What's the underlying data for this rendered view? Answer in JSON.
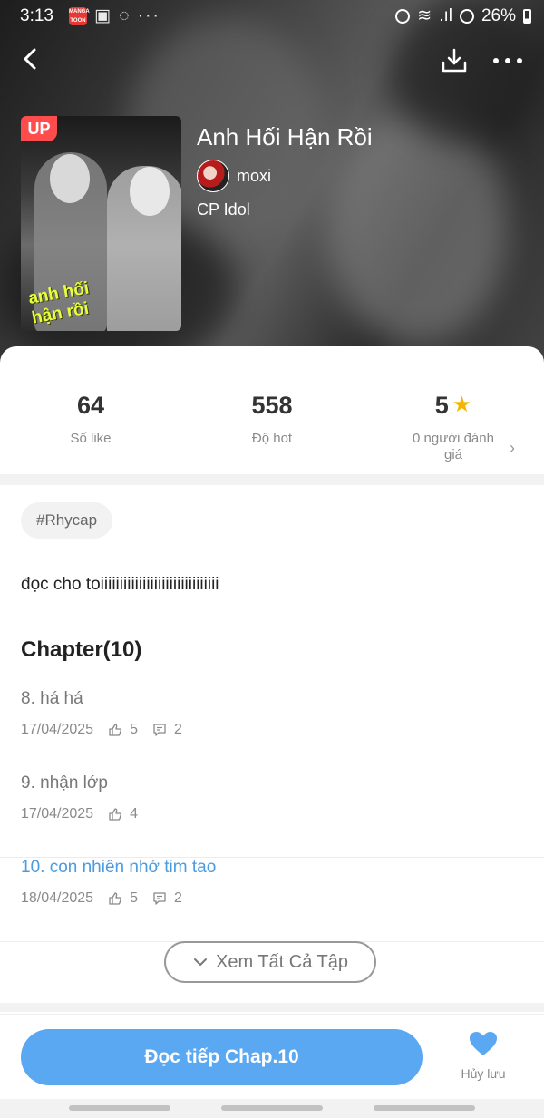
{
  "status_bar": {
    "time": "3:13",
    "battery": "26%"
  },
  "manga": {
    "title": "Anh Hối Hận Rồi",
    "author": "moxi",
    "genre": "CP Idol",
    "badge": "UP",
    "cover_caption_line1": "anh hối",
    "cover_caption_line2": "hận rồi"
  },
  "stats": {
    "likes": {
      "value": "64",
      "label": "Số like"
    },
    "hot": {
      "value": "558",
      "label": "Độ hot"
    },
    "rating": {
      "value": "5",
      "label_line1": "0 người đánh",
      "label_line2": "giá"
    }
  },
  "tag": "#Rhycap",
  "description": "đọc cho toiiiiiiiiiiiiiiiiiiiiiiiiiiiiiii",
  "chapters_title": "Chapter(10)",
  "chapters": [
    {
      "name": "8. há há",
      "date": "17/04/2025",
      "likes": "5",
      "comments": "2",
      "active": false
    },
    {
      "name": "9. nhận lớp",
      "date": "17/04/2025",
      "likes": "4",
      "comments": "",
      "active": false
    },
    {
      "name": "10. con nhiên nhớ tim tao",
      "date": "18/04/2025",
      "likes": "5",
      "comments": "2",
      "active": true
    }
  ],
  "see_all_label": "Xem Tất Cả Tập",
  "read_button_label": "Đọc tiếp Chap.10",
  "favorite_label": "Hủy lưu",
  "colors": {
    "accent": "#5aa7f2",
    "link": "#4a9be0",
    "star": "#f5b400",
    "badge": "#ff4d4d"
  }
}
